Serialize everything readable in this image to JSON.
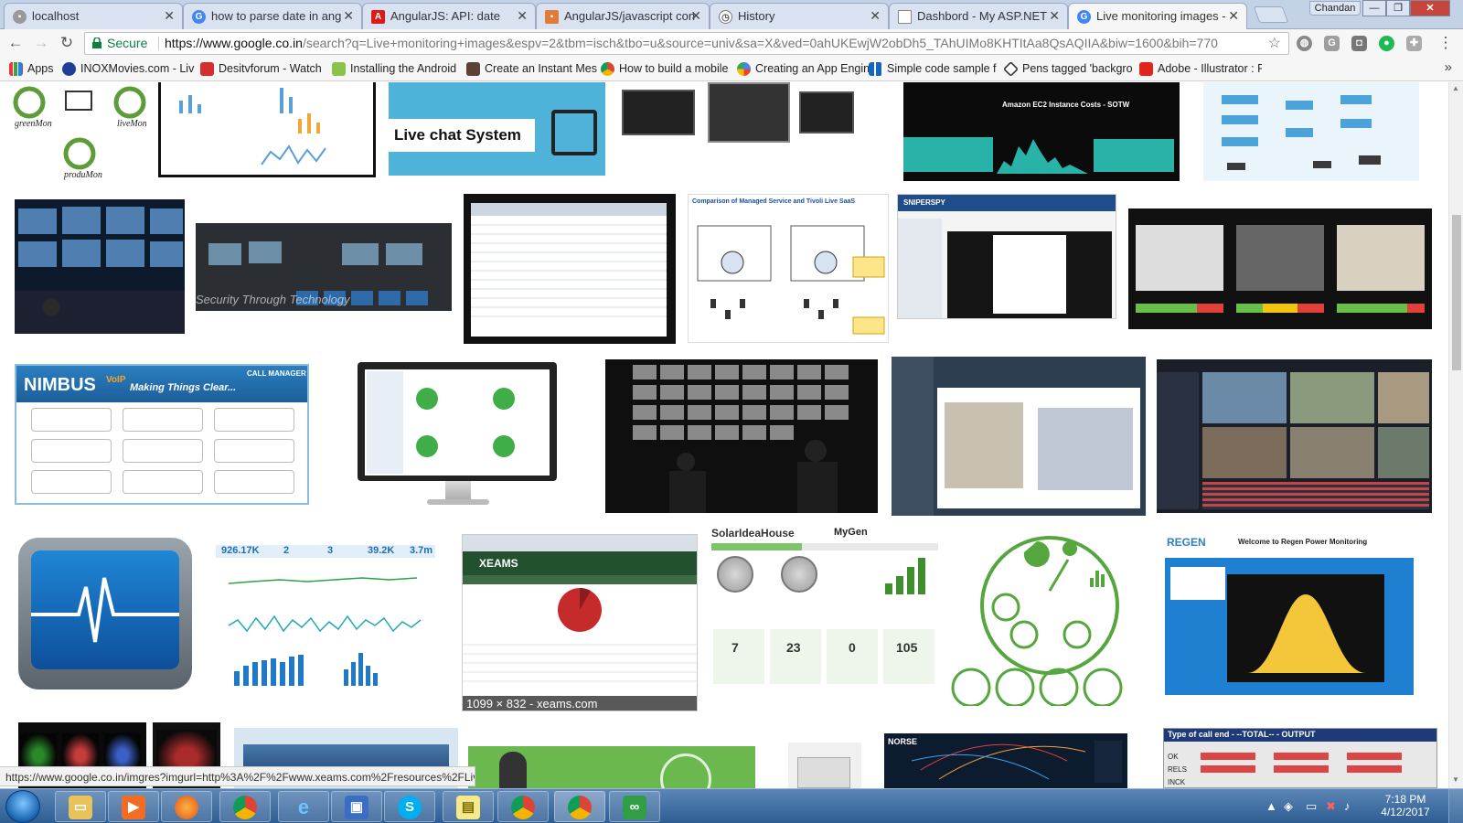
{
  "browser": {
    "tabs": [
      {
        "label": "localhost",
        "icon": "page-icon"
      },
      {
        "label": "how to parse date in ang",
        "icon": "google-icon"
      },
      {
        "label": "AngularJS: API: date",
        "icon": "angular-icon"
      },
      {
        "label": "AngularJS/javascript con",
        "icon": "page-icon"
      },
      {
        "label": "History",
        "icon": "history-icon"
      },
      {
        "label": "Dashbord - My ASP.NET",
        "icon": "page-icon"
      },
      {
        "label": "Live monitoring images -",
        "icon": "google-icon"
      }
    ],
    "active_tab": 6,
    "profile_name": "Chandan",
    "window_buttons": {
      "minimize": "—",
      "maximize": "❐",
      "close": "✕"
    }
  },
  "toolbar": {
    "secure_label": "Secure",
    "url_host": "https://www.google.co.in",
    "url_rest": "/search?q=Live+monitoring+images&espv=2&tbm=isch&tbo=u&source=univ&sa=X&ved=0ahUKEwjW2obDh5_TAhUIMo8KHTItAa8QsAQIIA&biw=1600&bih=770"
  },
  "bookmarks": [
    {
      "label": "Apps",
      "icon": "apps-grid-icon"
    },
    {
      "label": "INOXMovies.com - Liv",
      "icon": "inox-icon"
    },
    {
      "label": "Desitvforum - Watch",
      "icon": "desitv-icon"
    },
    {
      "label": "Installing the Android",
      "icon": "android-icon"
    },
    {
      "label": "Create an Instant Mes",
      "icon": "page-icon"
    },
    {
      "label": "How to build a mobile",
      "icon": "chrome-icon"
    },
    {
      "label": "Creating an App Engin",
      "icon": "google-icon"
    },
    {
      "label": "Simple code sample f",
      "icon": "grid-icon"
    },
    {
      "label": "Pens tagged 'backgro",
      "icon": "codepen-icon"
    },
    {
      "label": "Adobe - Illustrator : F",
      "icon": "adobe-icon"
    }
  ],
  "thumbnails_text": {
    "greenmon": "greenMon",
    "livemon": "liveMon",
    "produmon": "produMon",
    "live_chat": "Live chat System",
    "amazon_title": "Amazon EC2 Instance Costs - SOTW",
    "surveillance_caption": "Security Through Technology",
    "comparison_title": "Comparison of  Managed Service and Tivoli Live SaaS",
    "snipershy": "SNIPERSPY",
    "nimbus_brand": "NIMBUS",
    "nimbus_voip": "VoIP",
    "nimbus_slogan": "Making Things Clear...",
    "call_manager": "CALL MANAGER",
    "xeams_brand": "XEAMS",
    "xeams_caption": "1099 × 832 - xeams.com",
    "solar_brand": "SolarIdeaHouse",
    "mygen": "MyGen",
    "solar_values": [
      "7",
      "23",
      "0",
      "105"
    ],
    "regen_brand": "REGEN",
    "regen_title": "Welcome to Regen Power Monitoring",
    "stats_values": [
      "926.17K",
      "2",
      "3",
      "39.2K",
      "3.7m"
    ],
    "norse": "NORSE",
    "callend_title": "Type of call end - --TOTAL-- - OUTPUT",
    "callend_rows": [
      "OK",
      "RELS",
      "INCK"
    ]
  },
  "status_url": "https://www.google.co.in/imgres?imgurl=http%3A%2F%2Fwww.xeams.com%2Fresources%2FLive...",
  "taskbar": {
    "items": [
      {
        "name": "file-explorer",
        "icon": "folder-icon"
      },
      {
        "name": "media-player",
        "icon": "play-icon"
      },
      {
        "name": "firefox",
        "icon": "firefox-icon"
      },
      {
        "name": "chrome",
        "icon": "chrome-icon"
      },
      {
        "name": "internet-explorer",
        "icon": "ie-icon"
      },
      {
        "name": "remote-desktop",
        "icon": "monitor-icon"
      },
      {
        "name": "skype",
        "icon": "skype-icon"
      },
      {
        "name": "sticky-notes",
        "icon": "notes-icon"
      },
      {
        "name": "chrome-2",
        "icon": "chrome-icon"
      },
      {
        "name": "chrome-3",
        "icon": "chrome-icon"
      },
      {
        "name": "visual-studio",
        "icon": "vs-icon"
      }
    ],
    "time": "7:18 PM",
    "date": "4/12/2017"
  }
}
